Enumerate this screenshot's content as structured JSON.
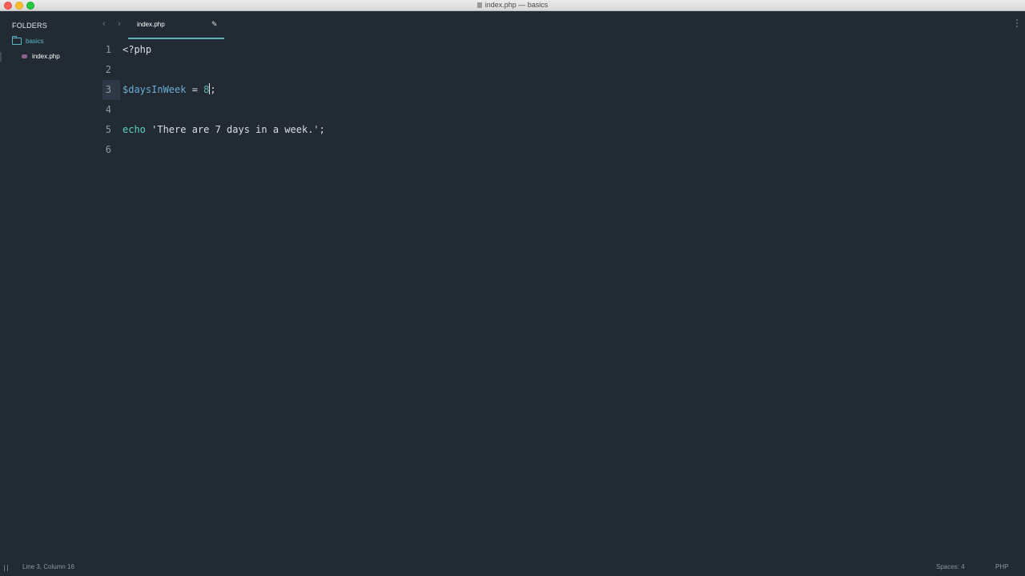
{
  "window": {
    "title": "index.php — basics"
  },
  "sidebar": {
    "header": "FOLDERS",
    "folder": {
      "name": "basics",
      "icon": "folder-icon"
    },
    "files": [
      {
        "name": "index.php",
        "icon": "php-file-icon"
      }
    ]
  },
  "tabs": [
    {
      "label": "index.php",
      "modified_icon": "pencil-icon"
    }
  ],
  "editor": {
    "active_line": 3,
    "lines": [
      {
        "number": "1",
        "code": "<?php"
      },
      {
        "number": "2",
        "code": ""
      },
      {
        "number": "3",
        "code": "$daysInWeek = 8;"
      },
      {
        "number": "4",
        "code": ""
      },
      {
        "number": "5",
        "code": "echo 'There are 7 days in a week.';"
      },
      {
        "number": "6",
        "code": ""
      }
    ],
    "tokens": {
      "php_open": "<?php",
      "variable": "$daysInWeek",
      "assign": " = ",
      "number": "8",
      "semicolon": ";",
      "echo": "echo",
      "string": " 'There are 7 days in a week.';"
    }
  },
  "statusbar": {
    "position": "Line 3, Column 16",
    "indentation": "Spaces: 4",
    "syntax": "PHP"
  },
  "colors": {
    "background": "#222b33",
    "accent": "#5fb3b3",
    "folder": "#59b7c9",
    "variable": "#6aaed6",
    "keyword": "#5fd3c4"
  }
}
